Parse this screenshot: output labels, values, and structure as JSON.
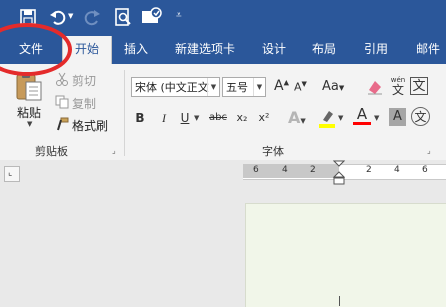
{
  "quick_access": {
    "icons": [
      "save-icon",
      "undo-icon",
      "undo-dropdown-icon",
      "redo-icon",
      "print-preview-icon",
      "touch-mode-icon",
      "customize-qat-icon"
    ]
  },
  "tabs": [
    {
      "label": "文件"
    },
    {
      "label": "开始"
    },
    {
      "label": "插入"
    },
    {
      "label": "新建选项卡"
    },
    {
      "label": "设计"
    },
    {
      "label": "布局"
    },
    {
      "label": "引用"
    },
    {
      "label": "邮件"
    }
  ],
  "clipboard": {
    "paste_label": "粘贴",
    "cut_label": "剪切",
    "copy_label": "复制",
    "format_painter_label": "格式刷",
    "group_label": "剪贴板"
  },
  "font": {
    "font_name": "宋体 (中文正文",
    "font_size": "五号",
    "wen_label": "wén",
    "wen_char": "文",
    "a_box_char": "A",
    "bold": "B",
    "italic": "I",
    "underline": "U",
    "strike": "abc",
    "sub": "x₂",
    "sup": "x²",
    "grow": "A",
    "shrink": "A",
    "aa": "Aa",
    "group_label": "字体",
    "highlight_color": "#ffff00",
    "font_color": "#ff0000"
  },
  "ruler": {
    "numbers": [
      "6",
      "4",
      "2",
      "2",
      "4",
      "6"
    ]
  },
  "colors": {
    "brand": "#2b579a",
    "ribbon": "#f3f3f3",
    "annotation": "#e42b2b"
  }
}
